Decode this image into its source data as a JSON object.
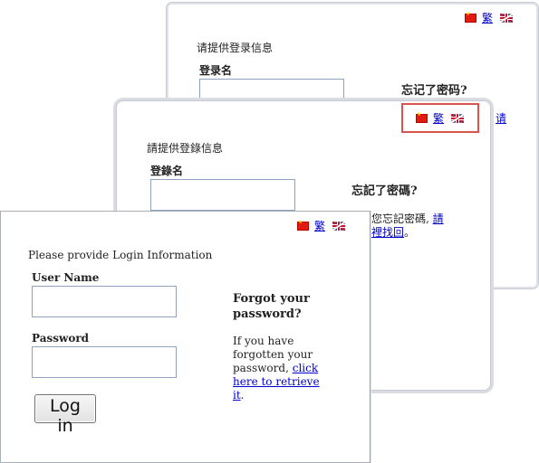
{
  "back_card": {
    "lang_trad": "繁",
    "prompt": "请提供登录信息",
    "username_label": "登录名",
    "forgot_title": "忘记了密码?",
    "partial_link": "请"
  },
  "mid_card": {
    "lang_trad": "繁",
    "prompt": "請提供登錄信息",
    "username_label": "登錄名",
    "forgot_title": "忘記了密碼?",
    "forgot_text_partial": "果您忘記密碼,",
    "forgot_link_1": "請",
    "forgot_link_2": "這裡找回",
    "forgot_end": "。"
  },
  "front_card": {
    "lang_trad": "繁",
    "prompt": "Please provide Login Information",
    "username_label": "User Name",
    "password_label": "Password",
    "forgot_title_1": "Forgot your",
    "forgot_title_2": "password?",
    "forgot_text_1": "If you have",
    "forgot_text_2": "forgotten your",
    "forgot_text_3": "password,",
    "forgot_link_a": "click",
    "forgot_link_b": "here to retrieve",
    "forgot_link_c": "it",
    "forgot_period": ".",
    "login_button": "Log in"
  },
  "colors": {
    "link": "#0000cc",
    "highlight_border": "#d9534f",
    "input_border": "#8fa3bd"
  }
}
